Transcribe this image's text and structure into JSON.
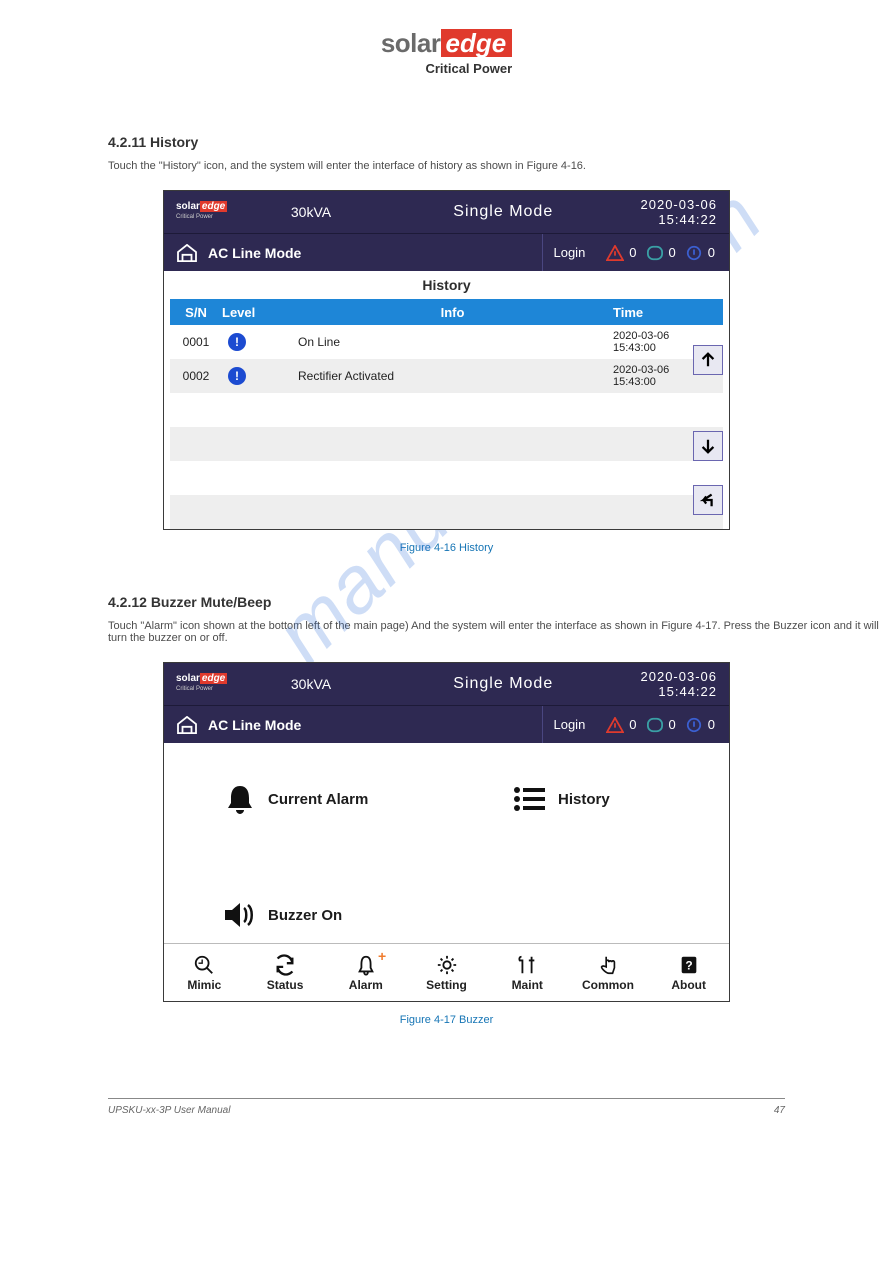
{
  "brand": {
    "solar": "solar",
    "edge": "edge",
    "subtitle": "Critical Power"
  },
  "sections": {
    "history": {
      "title": "4.2.11 History",
      "paragraph": "Touch the \"History\" icon, and the system will enter the interface of history as shown in Figure 4-16."
    },
    "buzzer": {
      "title": "4.2.12 Buzzer Mute/Beep",
      "paragraph": "Touch \"Alarm\" icon shown at the bottom left of the main page) And the system will enter the interface as shown in Figure 4-17. Press the Buzzer icon and it will turn the buzzer on or off."
    }
  },
  "device": {
    "kva": "30kVA",
    "mode": "Single  Mode",
    "date": "2020-03-06",
    "time": "15:44:22",
    "subbar_mode": "AC Line Mode",
    "login": "Login",
    "counts": {
      "warn": "0",
      "info": "0",
      "notice": "0"
    }
  },
  "history": {
    "title": "History",
    "columns": {
      "sn": "S/N",
      "level": "Level",
      "info": "Info",
      "time": "Time"
    },
    "rows": [
      {
        "sn": "0001",
        "info": "On Line",
        "date": "2020-03-06",
        "time": "15:43:00"
      },
      {
        "sn": "0002",
        "info": "Rectifier Activated",
        "date": "2020-03-06",
        "time": "15:43:00"
      }
    ]
  },
  "caption1": "Figure 4-16 History",
  "caption2": "Figure 4-17 Buzzer",
  "alarm_menu": {
    "current_alarm": "Current Alarm",
    "history": "History",
    "buzzer_on": "Buzzer On"
  },
  "nav": {
    "mimic": "Mimic",
    "status": "Status",
    "alarm": "Alarm",
    "setting": "Setting",
    "maint": "Maint",
    "common": "Common",
    "about": "About"
  },
  "footer": {
    "left": "UPSKU-xx-3P User Manual",
    "center": "",
    "right": "47"
  },
  "watermark": "manualshive.com"
}
